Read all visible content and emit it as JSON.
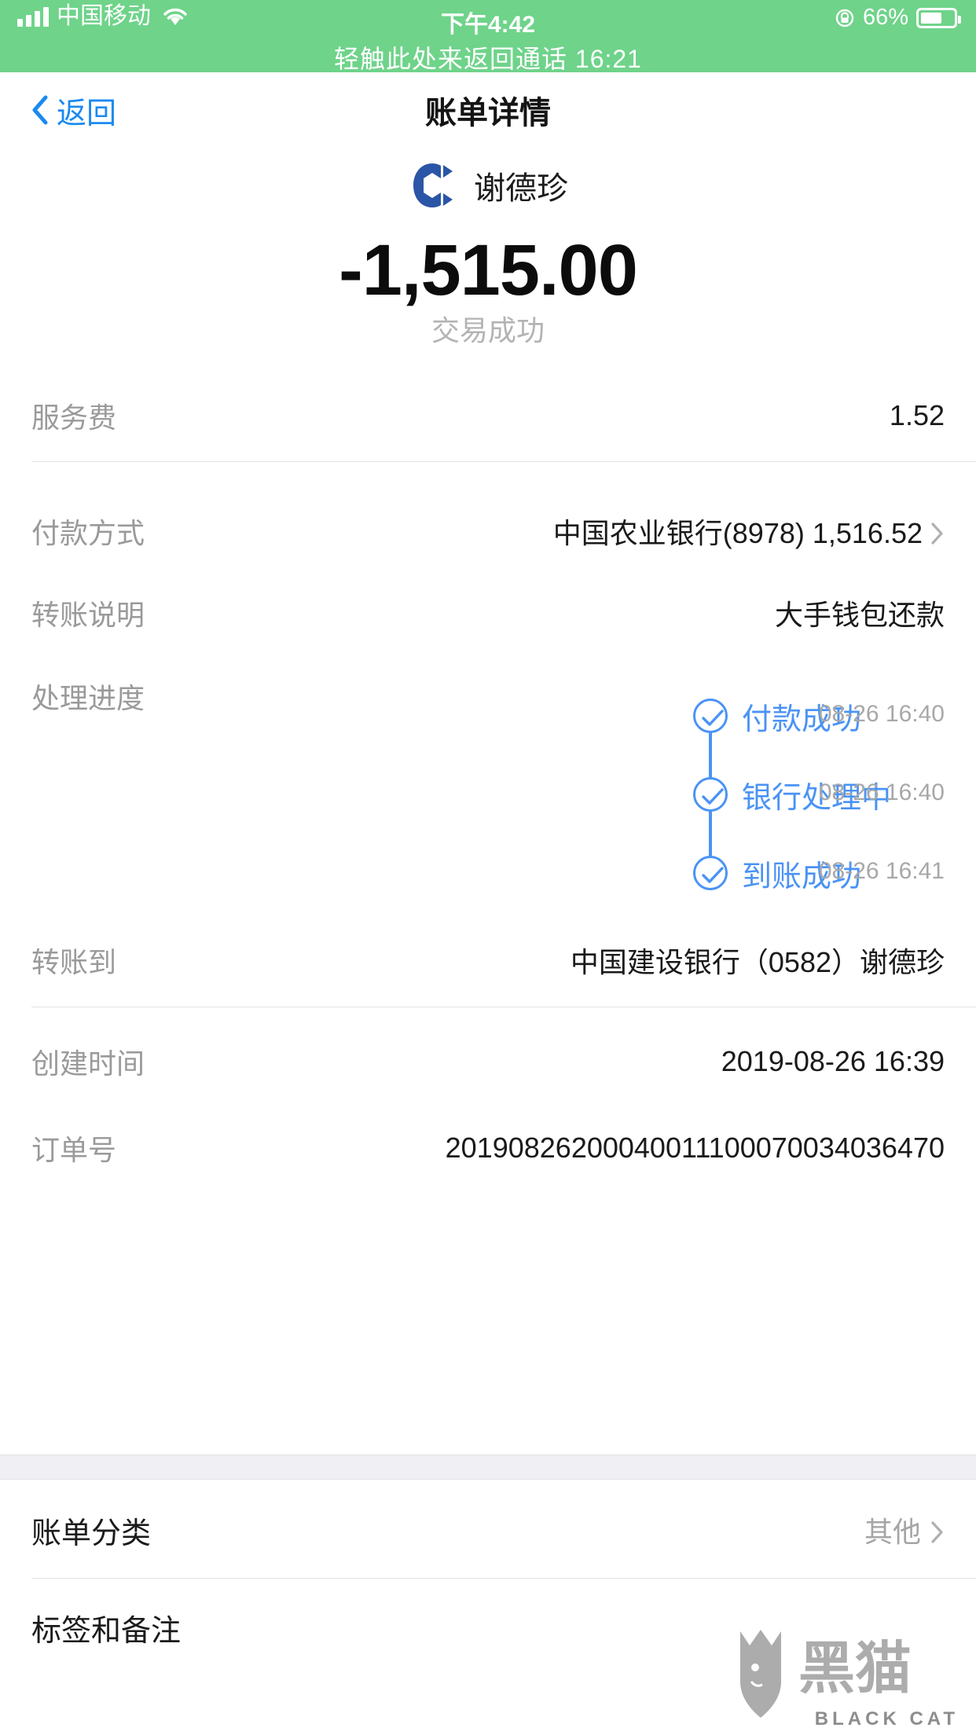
{
  "status_bar": {
    "carrier": "中国移动",
    "time": "下午4:42",
    "battery_percent": "66%",
    "call_banner": "轻触此处来返回通话 16:21"
  },
  "nav": {
    "back_label": "返回",
    "title": "账单详情"
  },
  "header": {
    "payee_name": "谢德珍",
    "amount": "-1,515.00",
    "trade_status": "交易成功"
  },
  "details": {
    "service_fee": {
      "label": "服务费",
      "value": "1.52"
    },
    "payment_method": {
      "label": "付款方式",
      "value": "中国农业银行(8978) 1,516.52"
    },
    "transfer_note": {
      "label": "转账说明",
      "value": "大手钱包还款"
    },
    "progress": {
      "label": "处理进度",
      "steps": [
        {
          "name": "付款成功",
          "time": "08-26 16:40"
        },
        {
          "name": "银行处理中",
          "time": "08-26 16:40"
        },
        {
          "name": "到账成功",
          "time": "08-26 16:41"
        }
      ]
    },
    "transfer_to": {
      "label": "转账到",
      "value": "中国建设银行（0582）谢德珍"
    },
    "created_time": {
      "label": "创建时间",
      "value": "2019-08-26 16:39"
    },
    "order_no": {
      "label": "订单号",
      "value": "20190826200040011100070034036470"
    }
  },
  "bottom": {
    "category": {
      "label": "账单分类",
      "value": "其他"
    },
    "tags_notes": {
      "label": "标签和备注",
      "value": ""
    }
  },
  "watermark": {
    "text": "BLACK CAT"
  },
  "colors": {
    "accent_blue": "#4a93f5",
    "banner_green": "#6fd38a",
    "muted_gray": "#9a9a9a"
  }
}
